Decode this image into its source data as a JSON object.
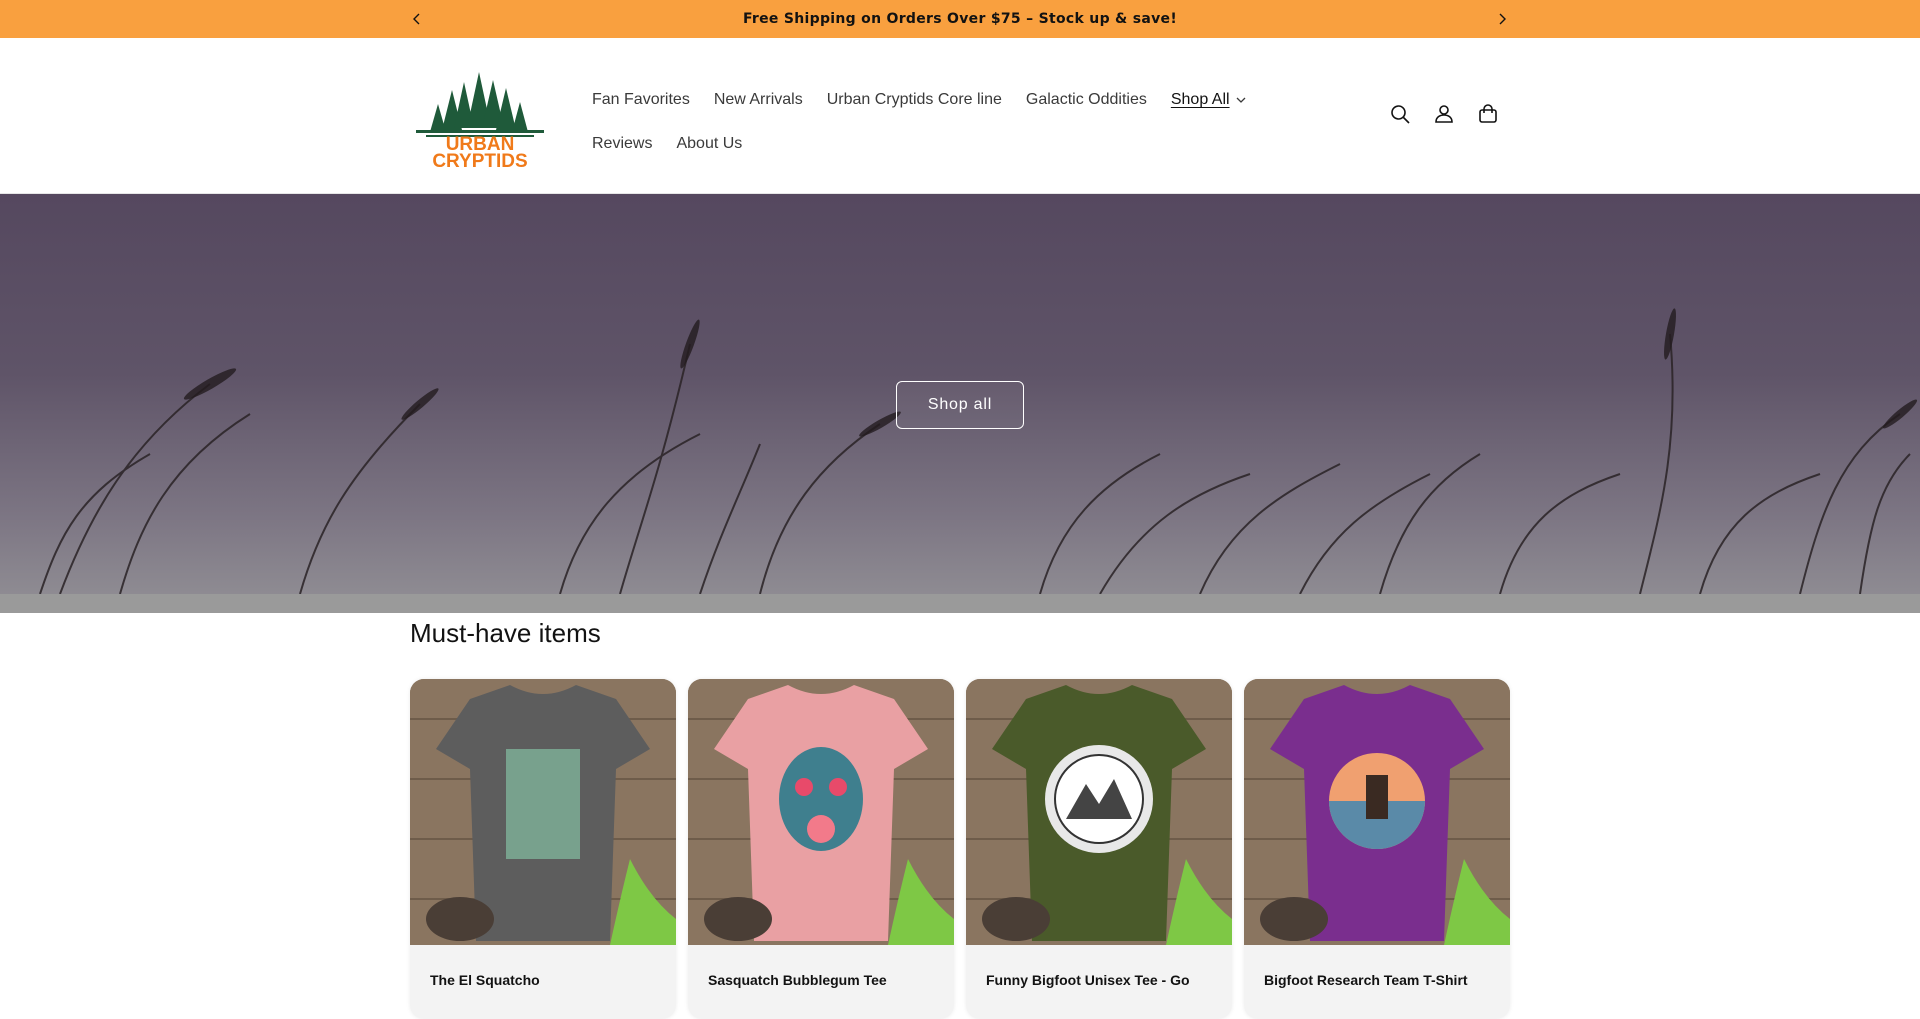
{
  "announcement": {
    "text": "Free Shipping on Orders Over $75 – Stock up & save!"
  },
  "header": {
    "logo_alt": "Urban Cryptids",
    "nav": [
      {
        "label": "Fan Favorites"
      },
      {
        "label": "New Arrivals"
      },
      {
        "label": "Urban Cryptids Core line"
      },
      {
        "label": "Galactic Oddities"
      },
      {
        "label": "Shop All"
      },
      {
        "label": "Reviews"
      },
      {
        "label": "About Us"
      }
    ]
  },
  "hero": {
    "button_label": "Shop all"
  },
  "products": {
    "title": "Must-have items",
    "items": [
      {
        "title": "The El Squatcho",
        "shirt_color": "#5d5d5d"
      },
      {
        "title": "Sasquatch Bubblegum Tee",
        "shirt_color": "#e9a0a3"
      },
      {
        "title": "Funny Bigfoot Unisex Tee - Go",
        "shirt_color": "#4a5a2a"
      },
      {
        "title": "Bigfoot Research Team T-Shirt",
        "shirt_color": "#7a2e8e"
      }
    ]
  },
  "colors": {
    "announcement_bg": "#f9a03f",
    "logo_green": "#1f5a3a",
    "logo_orange": "#f07a1a"
  }
}
